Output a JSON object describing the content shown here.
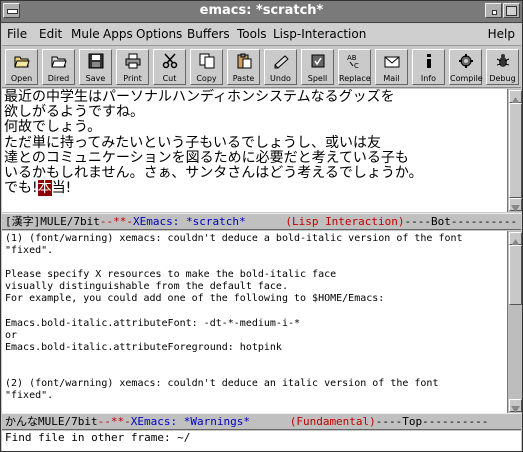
{
  "window": {
    "title": "emacs: *scratch*"
  },
  "menu": [
    "File",
    "Edit",
    "Mule",
    "Apps",
    "Options",
    "Buffers",
    "Tools",
    "Lisp-Interaction"
  ],
  "menu_help": "Help",
  "toolbar": [
    {
      "label": "Open",
      "icon": "folder-open-icon"
    },
    {
      "label": "Dired",
      "icon": "dired-folder-icon"
    },
    {
      "label": "Save",
      "icon": "floppy-disk-icon"
    },
    {
      "label": "Print",
      "icon": "printer-icon"
    },
    {
      "label": "Cut",
      "icon": "scissors-icon"
    },
    {
      "label": "Copy",
      "icon": "copy-icon"
    },
    {
      "label": "Paste",
      "icon": "paste-icon"
    },
    {
      "label": "Undo",
      "icon": "undo-icon"
    },
    {
      "label": "Spell",
      "icon": "spell-check-icon"
    },
    {
      "label": "Replace",
      "icon": "replace-icon"
    },
    {
      "label": "Mail",
      "icon": "mail-icon"
    },
    {
      "label": "Info",
      "icon": "info-icon"
    },
    {
      "label": "Compile",
      "icon": "compile-gear-icon"
    },
    {
      "label": "Debug",
      "icon": "debug-bug-icon"
    }
  ],
  "scratch": {
    "lines": [
      "最近の中学生はパーソナルハンディホンシステムなるグッズを",
      "欲しがるようですね。",
      "何故でしょう。",
      "ただ単に持ってみたいという子もいるでしょうし、或いは友",
      "達とのコミュニケーションを図るために必要だと考えている子も",
      "いるかもしれません。さぁ、サンタさんはどう考えるでしょうか。"
    ],
    "last_before": "でも!",
    "last_cursor": "本",
    "last_after": "当!"
  },
  "modeline1": {
    "prefix": "[漢字]MULE/7bit",
    "mod": "--**-",
    "app": "XEmacs:",
    "buffer": "*scratch*",
    "gap": "      ",
    "mode": "(Lisp Interaction)",
    "pos": "----Bot----------"
  },
  "warnings": {
    "lines": [
      "(1) (font/warning) xemacs: couldn't deduce a bold-italic version of the font",
      "\"fixed\".",
      "",
      "Please specify X resources to make the bold-italic face",
      "visually distinguishable from the default face.",
      "For example, you could add one of the following to $HOME/Emacs:",
      "",
      "Emacs.bold-italic.attributeFont: -dt-*-medium-i-*",
      "or",
      "Emacs.bold-italic.attributeForeground: hotpink",
      "",
      "",
      "(2) (font/warning) xemacs: couldn't deduce an italic version of the font",
      "\"fixed\"."
    ]
  },
  "modeline2": {
    "prefix": "かんなMULE/7bit",
    "mod": "--**-",
    "app": "XEmacs:",
    "buffer": "*Warnings*",
    "gap": "      ",
    "mode": "(Fundamental)",
    "pos": "----Top----------"
  },
  "minibuffer": "Find file in other frame: ~/"
}
